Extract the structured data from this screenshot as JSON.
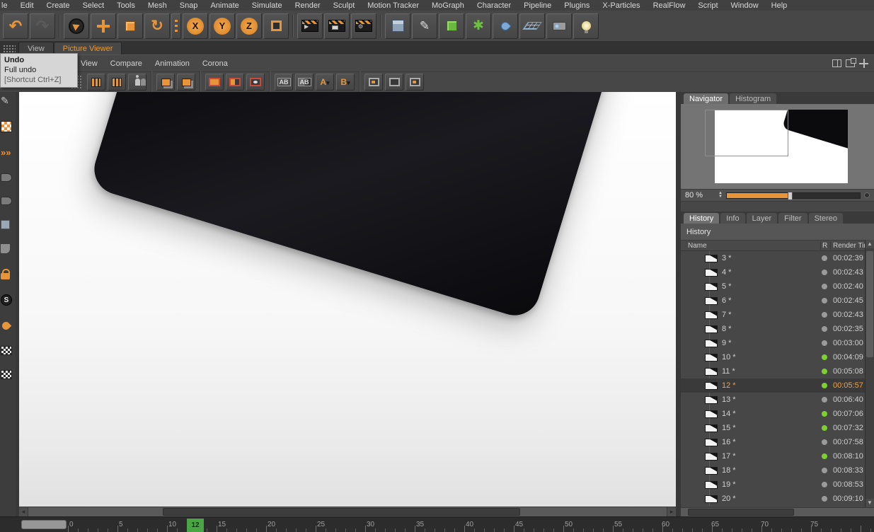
{
  "menubar": {
    "items": [
      "le",
      "Edit",
      "Create",
      "Select",
      "Tools",
      "Mesh",
      "Snap",
      "Animate",
      "Simulate",
      "Render",
      "Sculpt",
      "Motion Tracker",
      "MoGraph",
      "Character",
      "Pipeline",
      "Plugins",
      "X-Particles",
      "RealFlow",
      "Script",
      "Window",
      "Help"
    ]
  },
  "toolbar": {
    "x_label": "X",
    "y_label": "Y",
    "z_label": "Z"
  },
  "tabs": {
    "items": [
      {
        "label": "View"
      },
      {
        "label": "Picture Viewer"
      }
    ]
  },
  "tooltip": {
    "title": "Undo",
    "body": "Full undo",
    "shortcut": "[Shortcut Ctrl+Z]"
  },
  "pv_menu": {
    "items": [
      "View",
      "Compare",
      "Animation",
      "Corona"
    ]
  },
  "pv_toolbar": {
    "ab_label": "AB",
    "a_label": "A",
    "b_label": "B"
  },
  "navigator": {
    "tabs": [
      {
        "label": "Navigator"
      },
      {
        "label": "Histogram"
      }
    ],
    "zoom_value": "80 %"
  },
  "panel_tabs": {
    "items": [
      {
        "label": "History"
      },
      {
        "label": "Info"
      },
      {
        "label": "Layer"
      },
      {
        "label": "Filter"
      },
      {
        "label": "Stereo"
      }
    ]
  },
  "history": {
    "section_title": "History",
    "col_name": "Name",
    "col_r": "R",
    "col_time": "Render Tim",
    "rows": [
      {
        "name": "3 *",
        "time": "00:02:39",
        "status": "gray",
        "state": "normal"
      },
      {
        "name": "4 *",
        "time": "00:02:43",
        "status": "gray",
        "state": "normal"
      },
      {
        "name": "5 *",
        "time": "00:02:40",
        "status": "gray",
        "state": "normal"
      },
      {
        "name": "6 *",
        "time": "00:02:45",
        "status": "gray",
        "state": "normal"
      },
      {
        "name": "7 *",
        "time": "00:02:43",
        "status": "gray",
        "state": "normal"
      },
      {
        "name": "8 *",
        "time": "00:02:35",
        "status": "gray",
        "state": "normal"
      },
      {
        "name": "9 *",
        "time": "00:03:00",
        "status": "gray",
        "state": "normal"
      },
      {
        "name": "10 *",
        "time": "00:04:09",
        "status": "green",
        "state": "normal"
      },
      {
        "name": "11 *",
        "time": "00:05:08",
        "status": "green",
        "state": "normal"
      },
      {
        "name": "12 *",
        "time": "00:05:57",
        "status": "green",
        "state": "selected"
      },
      {
        "name": "13 *",
        "time": "00:06:40",
        "status": "gray",
        "state": "normal"
      },
      {
        "name": "14 *",
        "time": "00:07:06",
        "status": "green",
        "state": "normal"
      },
      {
        "name": "15 *",
        "time": "00:07:32",
        "status": "green",
        "state": "normal"
      },
      {
        "name": "16 *",
        "time": "00:07:58",
        "status": "gray",
        "state": "normal"
      },
      {
        "name": "17 *",
        "time": "00:08:10",
        "status": "green",
        "state": "normal"
      },
      {
        "name": "18 *",
        "time": "00:08:33",
        "status": "gray",
        "state": "normal"
      },
      {
        "name": "19 *",
        "time": "00:08:53",
        "status": "gray",
        "state": "normal"
      },
      {
        "name": "20 *",
        "time": "00:09:10",
        "status": "gray",
        "state": "normal"
      }
    ]
  },
  "left_toolbar": {
    "s_label": "S"
  },
  "timeline": {
    "ticks": [
      "0",
      "5",
      "10",
      "15",
      "20",
      "25",
      "30",
      "35",
      "40",
      "45",
      "50",
      "55",
      "60",
      "65",
      "70",
      "75"
    ],
    "marker": "12"
  }
}
